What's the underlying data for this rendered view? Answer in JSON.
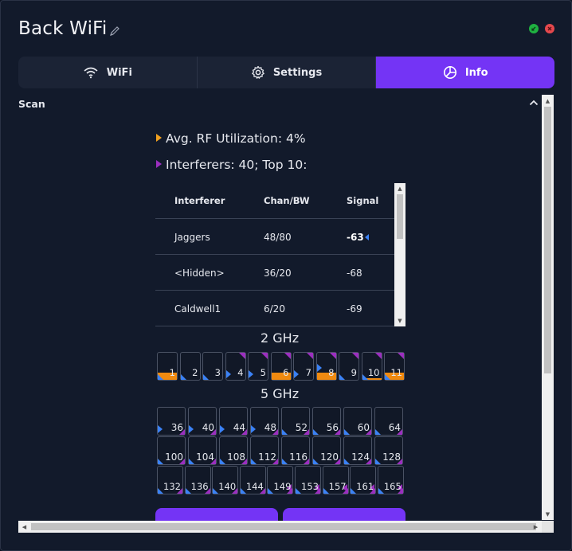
{
  "window": {
    "title": "Back WiFi",
    "minimize_color": "#1fb141",
    "close_color": "#e5484d"
  },
  "tabs": [
    {
      "label": "WiFi",
      "icon": "wifi-icon",
      "active": false
    },
    {
      "label": "Settings",
      "icon": "gear-icon",
      "active": false
    },
    {
      "label": "Info",
      "icon": "info-chart-icon",
      "active": true
    }
  ],
  "accent": "#7434f5",
  "scan": {
    "header": "Scan",
    "rf_utilization": "Avg. RF Utilization: 4%",
    "interferers_summary": "Interferers: 40; Top 10:",
    "table": {
      "headers": [
        "Interferer",
        "Chan/BW",
        "Signal"
      ],
      "rows": [
        {
          "name": "Jaggers",
          "chan": "48/80",
          "signal": "-63"
        },
        {
          "name": "<Hidden>",
          "chan": "36/20",
          "signal": "-68"
        },
        {
          "name": "Caldwell1",
          "chan": "6/20",
          "signal": "-69"
        }
      ]
    },
    "band_2g": {
      "label": "2 GHz",
      "channels": [
        "1",
        "2",
        "3",
        "4",
        "5",
        "6",
        "7",
        "8",
        "9",
        "10",
        "11"
      ]
    },
    "band_5g": {
      "label": "5 GHz",
      "row1": [
        "36",
        "40",
        "44",
        "48",
        "52",
        "56",
        "60",
        "64"
      ],
      "row2": [
        "100",
        "104",
        "108",
        "112",
        "116",
        "120",
        "124",
        "128"
      ],
      "row3": [
        "132",
        "136",
        "140",
        "144",
        "149",
        "153",
        "157",
        "161",
        "165"
      ]
    }
  }
}
